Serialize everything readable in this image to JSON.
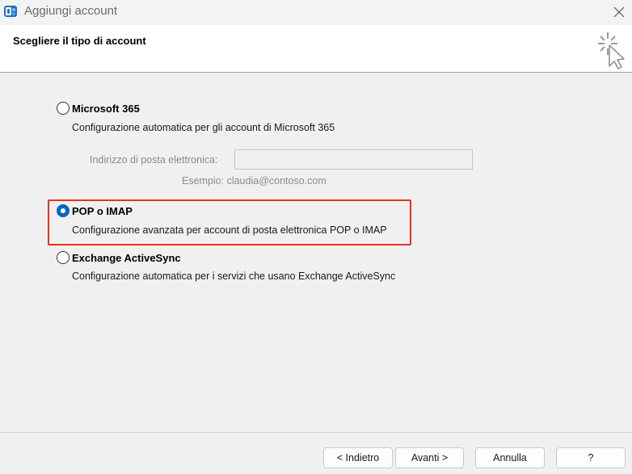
{
  "window": {
    "title": "Aggiungi account",
    "icon": "outlook-app-icon",
    "close_icon": "close-icon"
  },
  "header": {
    "title": "Scegliere il tipo di account",
    "icon": "cursor-sparkle-icon"
  },
  "options": {
    "microsoft365": {
      "label": "Microsoft 365",
      "description": "Configurazione automatica per gli account di Microsoft 365",
      "checked": false,
      "email_label": "Indirizzo di posta elettronica:",
      "email_value": "",
      "example": "Esempio: claudia@contoso.com"
    },
    "pop_imap": {
      "label": "POP o IMAP",
      "description": "Configurazione avanzata per account di posta elettronica POP o IMAP",
      "checked": true
    },
    "exchange": {
      "label": "Exchange ActiveSync",
      "description": "Configurazione automatica per i servizi che usano Exchange ActiveSync",
      "checked": false
    }
  },
  "buttons": {
    "back": "< Indietro",
    "next": "Avanti >",
    "cancel": "Annulla",
    "help": "?"
  },
  "colors": {
    "accent": "#0067c0",
    "highlight_border": "#e8311d"
  }
}
